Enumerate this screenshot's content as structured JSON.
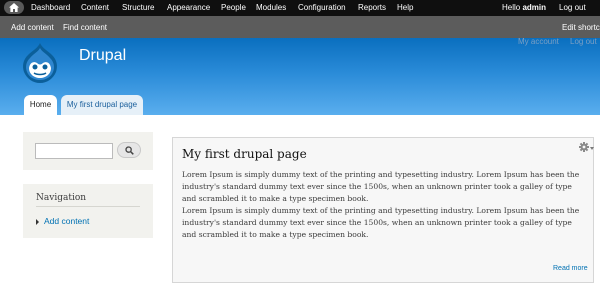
{
  "toolbar": {
    "menu": [
      "Dashboard",
      "Content",
      "Structure",
      "Appearance",
      "People",
      "Modules",
      "Configuration",
      "Reports",
      "Help"
    ],
    "hello_prefix": "Hello ",
    "hello_user": "admin",
    "logout": "Log out"
  },
  "shortcuts": {
    "add_content": "Add content",
    "find_content": "Find content",
    "edit_shortcuts": "Edit shortcuts"
  },
  "header": {
    "site_name": "Drupal",
    "my_account": "My account",
    "log_out": "Log out",
    "tabs": [
      "Home",
      "My first drupal page"
    ]
  },
  "sidebar": {
    "search": {
      "value": "",
      "placeholder": ""
    },
    "navigation": {
      "title": "Navigation",
      "items": [
        "Add content"
      ]
    }
  },
  "main": {
    "title": "My first drupal page",
    "paragraphs": [
      "Lorem Ipsum is simply dummy text of the printing and typesetting industry. Lorem Ipsum has been the industry's standard dummy text ever since the 1500s, when an unknown printer took a galley of type and scrambled it to make a type specimen book.",
      "Lorem Ipsum is simply dummy text of the printing and typesetting industry. Lorem Ipsum has been the industry's standard dummy text ever since the 1500s, when an unknown printer took a galley of type and scrambled it to make a type specimen book."
    ],
    "read_more": "Read more"
  },
  "icons": [
    "home-icon",
    "drupal-logo-icon",
    "search-icon",
    "gear-icon"
  ],
  "colors": {
    "toolbar": "#0f0f0f",
    "shortcut_bar": "#5c5c5c",
    "header_top": "#0a6fbf",
    "header_bottom": "#5aaeee",
    "link": "#0071b3"
  }
}
